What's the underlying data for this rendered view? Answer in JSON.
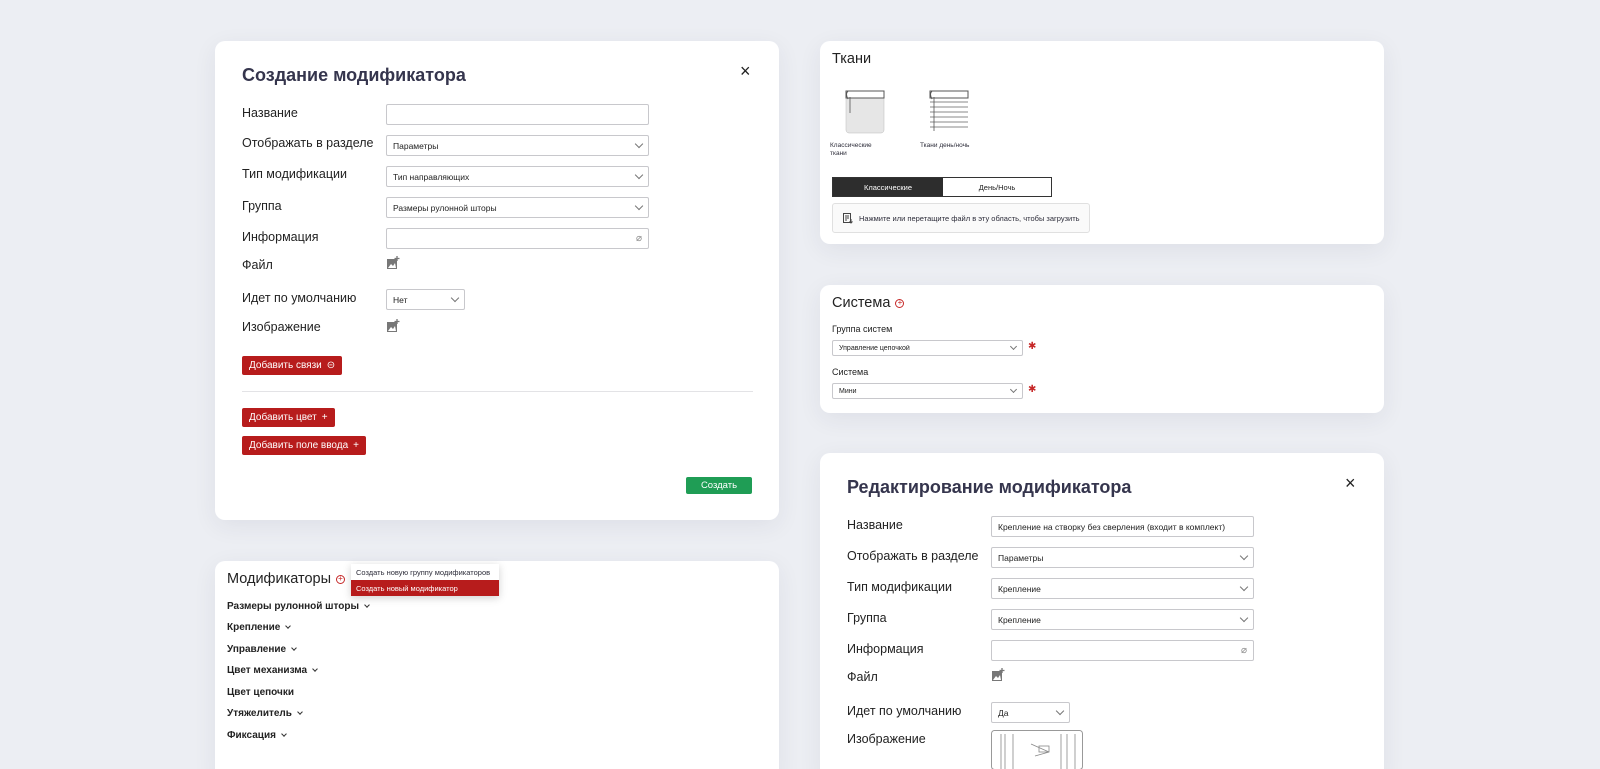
{
  "create_modal": {
    "title": "Создание модификатора",
    "close": "×",
    "fields": {
      "name_label": "Название",
      "section_label": "Отображать в разделе",
      "section_value": "Параметры",
      "type_label": "Тип модификации",
      "type_value": "Тип направляющих",
      "group_label": "Группа",
      "group_value": "Размеры рулонной шторы",
      "info_label": "Информация",
      "file_label": "Файл",
      "default_label": "Идет по умолчанию",
      "default_value": "Нет",
      "image_label": "Изображение"
    },
    "add_links": "Добавить связи",
    "add_color": "Добавить цвет",
    "add_input": "Добавить поле ввода",
    "plus": "+",
    "create": "Создать"
  },
  "fabrics": {
    "title": "Ткани",
    "options": [
      "Классические ткани",
      "Ткани день/ночь"
    ],
    "tabs": [
      "Классические",
      "День/Ночь"
    ],
    "upload_hint": "Нажмите или перетащите файл в эту область, чтобы загрузить"
  },
  "system": {
    "title": "Система",
    "group_label": "Группа систем",
    "group_value": "Управление цепочкой",
    "system_label": "Система",
    "system_value": "Мини"
  },
  "modifiers": {
    "title": "Модификаторы",
    "menu": [
      "Создать новую группу модификаторов",
      "Создать новый модификатор"
    ],
    "items": [
      {
        "label": "Размеры рулонной шторы",
        "chevron": true
      },
      {
        "label": "Крепление",
        "chevron": true
      },
      {
        "label": "Управление",
        "chevron": true
      },
      {
        "label": "Цвет механизма",
        "chevron": true
      },
      {
        "label": "Цвет цепочки",
        "chevron": false
      },
      {
        "label": "Утяжелитель",
        "chevron": true
      },
      {
        "label": "Фиксация",
        "chevron": true
      }
    ]
  },
  "edit_modal": {
    "title": "Редактирование модификатора",
    "close": "×",
    "fields": {
      "name_label": "Название",
      "name_value": "Крепление на створку без сверления (входит в комплект)",
      "section_label": "Отображать в разделе",
      "section_value": "Параметры",
      "type_label": "Тип модификации",
      "type_value": "Крепление",
      "group_label": "Группа",
      "group_value": "Крепление",
      "info_label": "Информация",
      "file_label": "Файл",
      "default_label": "Идет по умолчанию",
      "default_value": "Да",
      "image_label": "Изображение"
    }
  },
  "colors": {
    "accent": "#b71c1c",
    "success": "#1f9d55",
    "background": "#eceef3"
  }
}
